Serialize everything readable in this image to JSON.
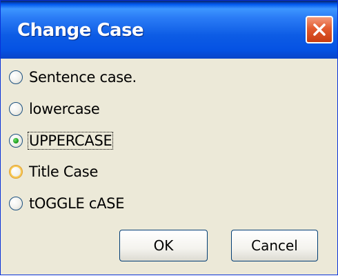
{
  "window": {
    "title": "Change Case"
  },
  "options": [
    {
      "label": "Sentence case.",
      "selected": false
    },
    {
      "label": "lowercase",
      "selected": false
    },
    {
      "label": "UPPERCASE",
      "selected": true
    },
    {
      "label": "Title Case",
      "selected": false
    },
    {
      "label": "tOGGLE cASE",
      "selected": false
    }
  ],
  "buttons": {
    "ok": "OK",
    "cancel": "Cancel"
  },
  "colors": {
    "title_bar": "#0552e3",
    "close_button": "#e25b2f",
    "dialog_bg": "#ece9d8",
    "radio_dot": "#21a121"
  },
  "icons": {
    "close": "close-icon"
  }
}
